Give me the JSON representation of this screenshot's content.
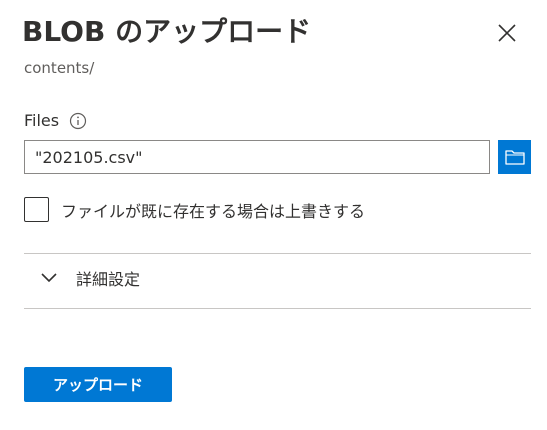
{
  "panel": {
    "title": "BLOB のアップロード",
    "subtitle": "contents/",
    "close_icon": "close-icon"
  },
  "files": {
    "label": "Files",
    "info_icon": "info-icon",
    "value": "\"202105.csv\"",
    "browse_icon": "folder-icon"
  },
  "overwrite": {
    "label": "ファイルが既に存在する場合は上書きする",
    "checked": false
  },
  "advanced": {
    "label": "詳細設定",
    "icon": "chevron-down-icon",
    "expanded": false
  },
  "actions": {
    "upload_label": "アップロード"
  },
  "colors": {
    "accent": "#0078d4",
    "text": "#323130",
    "subtext": "#605e5c",
    "border": "#8a8886",
    "divider": "#c8c6c4"
  }
}
